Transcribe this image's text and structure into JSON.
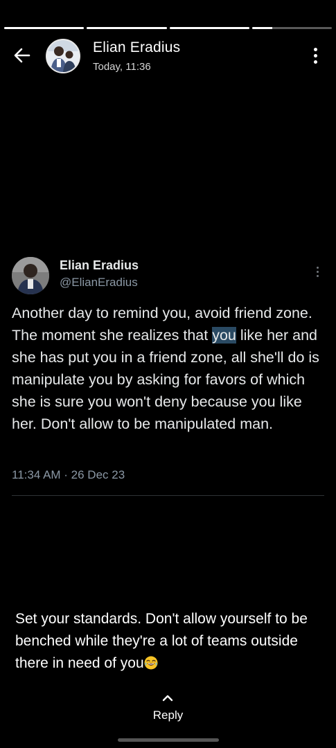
{
  "story": {
    "segments": [
      1,
      1,
      1,
      0.25
    ]
  },
  "header": {
    "name": "Elian Eradius",
    "time": "Today, 11:36"
  },
  "tweet": {
    "name": "Elian Eradius",
    "handle": "@ElianEradius",
    "text_before": "Another day to remind you, avoid friend zone. The moment she realizes that ",
    "text_highlight": "you",
    "text_after": " like her and she has put you in a friend zone, all she'll do is manipulate you by asking for favors of which she is sure you won't deny because you like her. Don't allow to be manipulated man.",
    "meta": "11:34 AM · 26 Dec 23"
  },
  "caption": {
    "text": "Set your standards. Don't allow yourself to be benched while they're a lot of teams outside there in need of you",
    "emoji": "face-with-tears-of-joy"
  },
  "reply": {
    "label": "Reply"
  },
  "icons": {
    "back": "arrow-left-icon",
    "menu": "more-vertical-icon",
    "tweet_more": "more-vertical-icon",
    "reply": "chevron-up-icon"
  },
  "colors": {
    "background": "#000000",
    "text_primary": "#e7e9ea",
    "text_secondary": "#8b98a5",
    "highlight": "#2a4a63"
  }
}
